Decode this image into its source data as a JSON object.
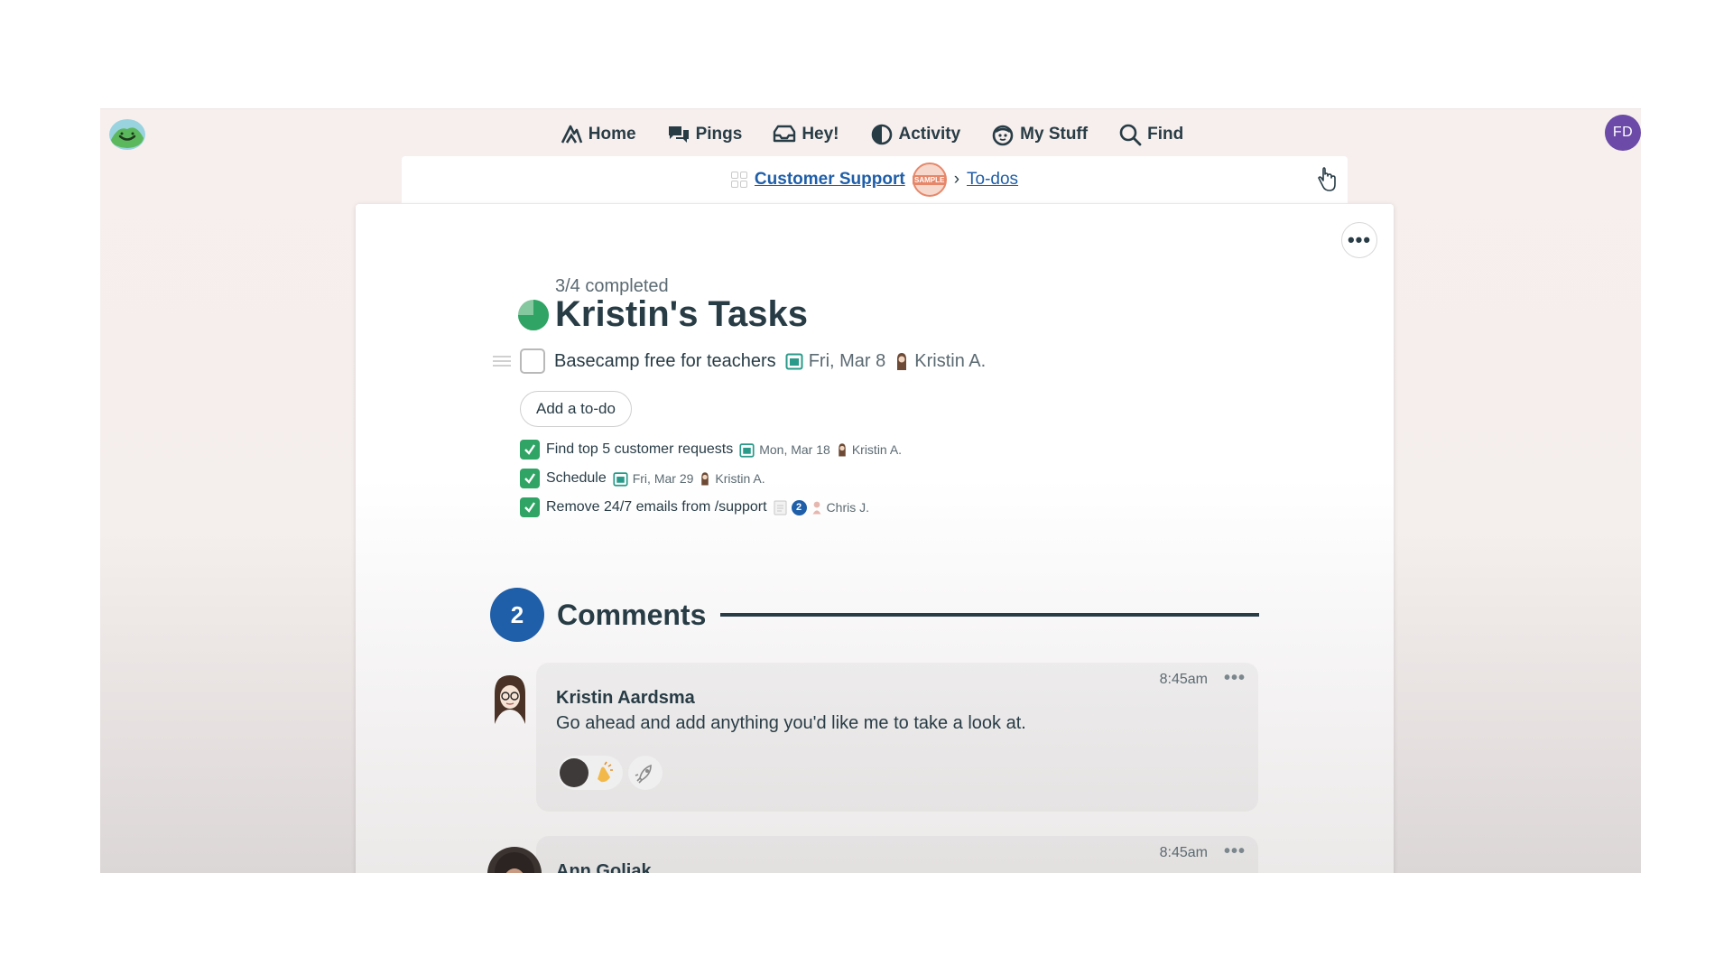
{
  "nav": {
    "items": [
      {
        "label": "Home",
        "icon": "home-icon"
      },
      {
        "label": "Pings",
        "icon": "pings-icon"
      },
      {
        "label": "Hey!",
        "icon": "hey-inbox-icon"
      },
      {
        "label": "Activity",
        "icon": "activity-icon"
      },
      {
        "label": "My Stuff",
        "icon": "my-stuff-icon"
      },
      {
        "label": "Find",
        "icon": "search-icon"
      }
    ],
    "user_initials": "FD"
  },
  "breadcrumb": {
    "project": "Customer Support",
    "badge": "SAMPLE",
    "separator": "›",
    "section": "To-dos"
  },
  "list": {
    "progress": "3/4 completed",
    "progress_fraction": 0.75,
    "title": "Kristin's Tasks",
    "open_todos": [
      {
        "title": "Basecamp free for teachers",
        "due": "Fri, Mar 8",
        "assignee": "Kristin A."
      }
    ],
    "add_label": "Add a to-do",
    "completed_todos": [
      {
        "title": "Find top 5 customer requests",
        "due": "Mon, Mar 18",
        "assignee": "Kristin A."
      },
      {
        "title": "Schedule",
        "due": "Fri, Mar 29",
        "assignee": "Kristin A."
      },
      {
        "title": "Remove 24/7 emails from /support",
        "comments": "2",
        "assignee": "Chris J."
      }
    ]
  },
  "comments": {
    "count": "2",
    "heading": "Comments",
    "items": [
      {
        "author": "Kristin Aardsma",
        "time": "8:45am",
        "body": "Go ahead and add anything you'd like me to take a look at."
      },
      {
        "author": "Ann Goliak",
        "time": "8:45am",
        "body": ""
      }
    ]
  },
  "colors": {
    "accent_blue": "#1f5ea8",
    "done_green": "#2fa465",
    "text": "#283c46",
    "avatar_purple": "#6b4aa8"
  }
}
